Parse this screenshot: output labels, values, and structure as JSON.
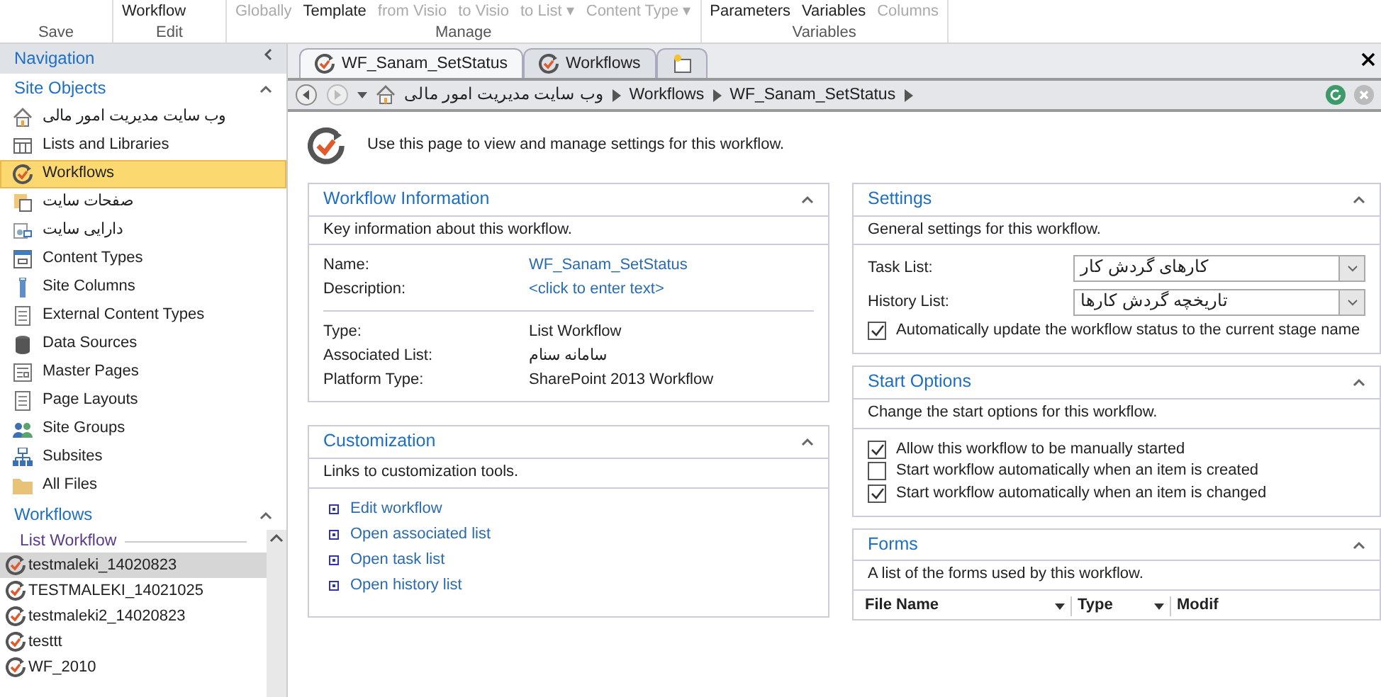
{
  "ribbon": {
    "groups": [
      {
        "label": "Save"
      },
      {
        "label": "Edit",
        "buttons": [
          {
            "label": "Workflow",
            "disabled": false
          }
        ]
      },
      {
        "label": "Manage",
        "buttons": [
          {
            "label": "Globally",
            "disabled": true
          },
          {
            "label": "Template",
            "disabled": false
          },
          {
            "label": "from Visio",
            "disabled": true
          },
          {
            "label": "to Visio",
            "disabled": true
          },
          {
            "label": "to List ▾",
            "disabled": true
          },
          {
            "label": "Content Type ▾",
            "disabled": true
          }
        ]
      },
      {
        "label": "Variables",
        "buttons": [
          {
            "label": "Parameters",
            "disabled": false
          },
          {
            "label": "Variables",
            "disabled": false
          },
          {
            "label": "Columns",
            "disabled": true
          }
        ]
      }
    ]
  },
  "navigation": {
    "title": "Navigation",
    "site_objects": {
      "title": "Site Objects",
      "items": [
        {
          "kind": "home",
          "label": "وب سایت مدیریت امور مالی",
          "selected": false
        },
        {
          "kind": "list",
          "label": "Lists and Libraries",
          "selected": false
        },
        {
          "kind": "workflow",
          "label": "Workflows",
          "selected": true
        },
        {
          "kind": "pages",
          "label": "صفحات سایت",
          "selected": false
        },
        {
          "kind": "assets",
          "label": "دارایی سایت",
          "selected": false
        },
        {
          "kind": "ctype",
          "label": "Content Types",
          "selected": false
        },
        {
          "kind": "column",
          "label": "Site Columns",
          "selected": false
        },
        {
          "kind": "doc",
          "label": "External Content Types",
          "selected": false
        },
        {
          "kind": "db",
          "label": "Data Sources",
          "selected": false
        },
        {
          "kind": "master",
          "label": "Master Pages",
          "selected": false
        },
        {
          "kind": "doc",
          "label": "Page Layouts",
          "selected": false
        },
        {
          "kind": "people",
          "label": "Site Groups",
          "selected": false
        },
        {
          "kind": "tree",
          "label": "Subsites",
          "selected": false
        },
        {
          "kind": "folder",
          "label": "All Files",
          "selected": false
        }
      ]
    },
    "workflows": {
      "title": "Workflows",
      "subheader": "List Workflow",
      "items": [
        {
          "label": "testmaleki_14020823",
          "selected": true
        },
        {
          "label": "TESTMALEKI_14021025",
          "selected": false
        },
        {
          "label": "testmaleki2_14020823",
          "selected": false
        },
        {
          "label": "testtt",
          "selected": false
        },
        {
          "label": "WF_2010",
          "selected": false
        }
      ]
    }
  },
  "tabs": [
    {
      "label": "WF_Sanam_SetStatus",
      "selected": true
    },
    {
      "label": "Workflows",
      "selected": false
    }
  ],
  "breadcrumb": [
    "وب سایت مدیریت امور مالی",
    "Workflows",
    "WF_Sanam_SetStatus"
  ],
  "intro": "Use this page to view and manage settings for this workflow.",
  "workflow_information": {
    "title": "Workflow Information",
    "description": "Key information about this workflow.",
    "groups": [
      [
        {
          "label": "Name:",
          "value": "WF_Sanam_SetStatus",
          "kind": "link"
        },
        {
          "label": "Description:",
          "value": "<click to enter text>",
          "kind": "link"
        }
      ],
      [
        {
          "label": "Type:",
          "value": "List Workflow",
          "kind": "text"
        },
        {
          "label": "Associated List:",
          "value": "سامانه سنام",
          "kind": "text"
        },
        {
          "label": "Platform Type:",
          "value": "SharePoint 2013 Workflow",
          "kind": "text"
        }
      ]
    ]
  },
  "customization": {
    "title": "Customization",
    "description": "Links to customization tools.",
    "links": [
      "Edit workflow",
      "Open associated list",
      "Open task list",
      "Open history list"
    ]
  },
  "settings": {
    "title": "Settings",
    "description": "General settings for this workflow.",
    "selects": [
      {
        "label": "Task List:",
        "value": "کارهای گردش کار"
      },
      {
        "label": "History List:",
        "value": "تاریخچه گردش کارها"
      }
    ],
    "options": [
      {
        "label": "Automatically update the workflow status to the current stage name",
        "checked": true
      }
    ]
  },
  "start_options": {
    "title": "Start Options",
    "description": "Change the start options for this workflow.",
    "options": [
      {
        "label": "Allow this workflow to be manually started",
        "checked": true
      },
      {
        "label": "Start workflow automatically when an item is created",
        "checked": false
      },
      {
        "label": "Start workflow automatically when an item is changed",
        "checked": true
      }
    ]
  },
  "forms": {
    "title": "Forms",
    "description": "A list of the forms used by this workflow.",
    "columns": [
      "File Name",
      "Type",
      "Modif"
    ]
  }
}
